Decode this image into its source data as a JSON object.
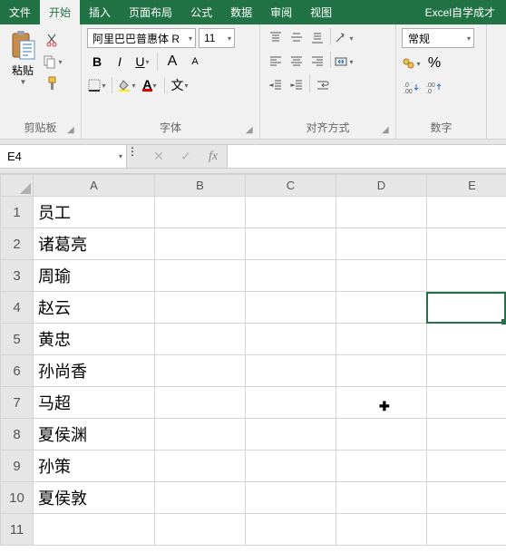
{
  "menu": {
    "file": "文件",
    "home": "开始",
    "insert": "插入",
    "page_layout": "页面布局",
    "formulas": "公式",
    "data": "数据",
    "review": "审阅",
    "view": "视图",
    "brand": "Excel自学成才"
  },
  "ribbon": {
    "clipboard": {
      "label": "剪贴板",
      "paste": "粘贴"
    },
    "font": {
      "label": "字体",
      "name": "阿里巴巴普惠体 R",
      "size": "11",
      "bold": "B",
      "italic": "I",
      "underline": "U",
      "grow": "A",
      "shrink": "A"
    },
    "alignment": {
      "label": "对齐方式"
    },
    "number": {
      "label": "数字",
      "format": "常规",
      "percent": "%"
    }
  },
  "formula_bar": {
    "name_box": "E4",
    "fx": "fx",
    "formula": ""
  },
  "grid": {
    "columns": [
      "A",
      "B",
      "C",
      "D",
      "E"
    ],
    "rows": [
      {
        "n": "1",
        "A": "员工"
      },
      {
        "n": "2",
        "A": "诸葛亮"
      },
      {
        "n": "3",
        "A": "周瑜"
      },
      {
        "n": "4",
        "A": "赵云"
      },
      {
        "n": "5",
        "A": "黄忠"
      },
      {
        "n": "6",
        "A": "孙尚香"
      },
      {
        "n": "7",
        "A": "马超"
      },
      {
        "n": "8",
        "A": "夏侯渊"
      },
      {
        "n": "9",
        "A": "孙策"
      },
      {
        "n": "10",
        "A": "夏侯敦"
      },
      {
        "n": "11",
        "A": ""
      }
    ],
    "active_cell": "E4"
  }
}
